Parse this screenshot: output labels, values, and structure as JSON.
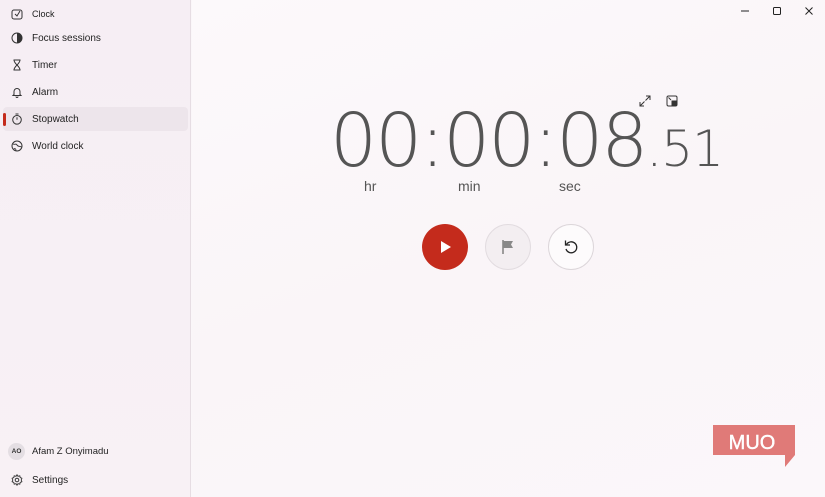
{
  "app": {
    "title": "Clock"
  },
  "sidebar": {
    "items": [
      {
        "label": "Focus sessions",
        "icon": "focus-icon",
        "selected": false
      },
      {
        "label": "Timer",
        "icon": "hourglass-icon",
        "selected": false
      },
      {
        "label": "Alarm",
        "icon": "bell-icon",
        "selected": false
      },
      {
        "label": "Stopwatch",
        "icon": "stopwatch-icon",
        "selected": true
      },
      {
        "label": "World clock",
        "icon": "globe-icon",
        "selected": false
      }
    ],
    "user": {
      "initials": "AO",
      "name": "Afam Z Onyimadu"
    },
    "settings_label": "Settings"
  },
  "stopwatch": {
    "hours": "00",
    "minutes": "00",
    "seconds": "08",
    "hundredths": "51",
    "sep": ":",
    "dot": ".",
    "unit_hr": "hr",
    "unit_min": "min",
    "unit_sec": "sec"
  },
  "watermark": {
    "text": "MUO"
  },
  "colors": {
    "accent": "#c42b1c",
    "digits": "#555555"
  }
}
